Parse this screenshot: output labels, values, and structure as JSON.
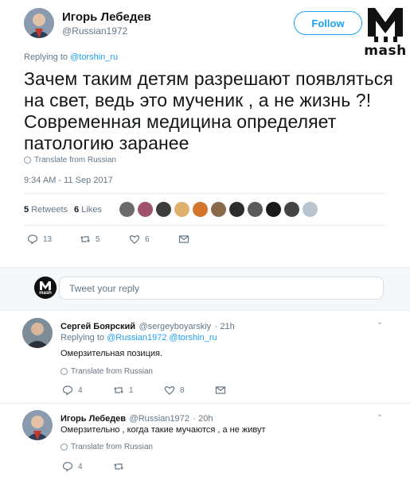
{
  "main_tweet": {
    "author_name": "Игорь Лебедев",
    "author_handle": "@Russian1972",
    "follow_label": "Follow",
    "replying_prefix": "Replying to ",
    "replying_to": "@torshin_ru",
    "text": "Зачем таким детям разрешают появляться на свет, ведь это мученик , а не жизнь ?! Современная медицина определяет патологию заранее",
    "translate_label": "Translate from Russian",
    "timestamp": "9:34 AM - 11 Sep 2017",
    "retweets_count": "5",
    "retweets_label": "Retweets",
    "likes_count": "6",
    "likes_label": "Likes",
    "actions": {
      "reply_count": "13",
      "retweet_count": "5",
      "like_count": "6"
    }
  },
  "watermark": {
    "text": "mash"
  },
  "reply_box": {
    "placeholder": "Tweet your reply",
    "avatar_text": "mash"
  },
  "replies": [
    {
      "author_name": "Сергей Боярский",
      "author_handle": "@sergeyboyarskiy",
      "time": "· 21h",
      "replying_prefix": "Replying to ",
      "replying_to": "@Russian1972 @torshin_ru",
      "text": "Омерзительная позиция.",
      "translate_label": "Translate from Russian",
      "reply_count": "4",
      "retweet_count": "1",
      "like_count": "8"
    },
    {
      "author_name": "Игорь Лебедев",
      "author_handle": "@Russian1972",
      "time": "· 20h",
      "text": "Омерзительно , когда такие мучаются , а не живут",
      "translate_label": "Translate from Russian",
      "reply_count": "4"
    }
  ],
  "colors": {
    "link": "#1da1f2",
    "muted": "#657786",
    "text": "#14171a",
    "divider": "#e6ecf0"
  }
}
